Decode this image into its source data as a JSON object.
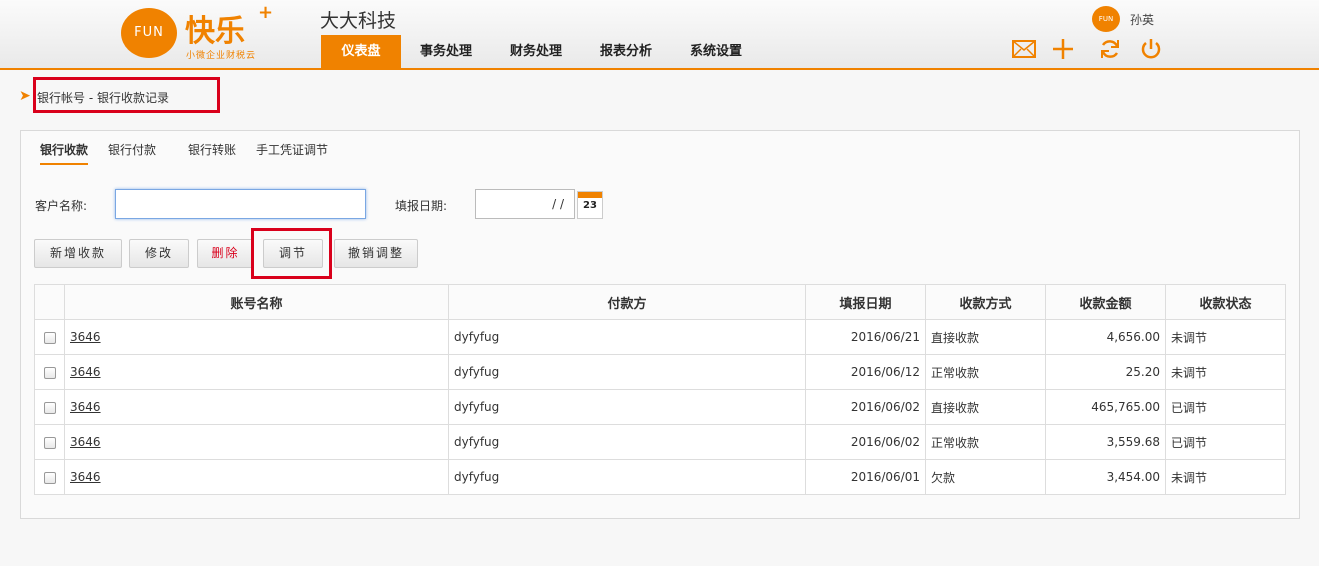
{
  "header": {
    "logo_text": "FUN",
    "logo_name": "快乐",
    "logo_plus": "+",
    "logo_slogan": "小微企业财税云",
    "company": "大大科技",
    "nav": [
      "仪表盘",
      "事务处理",
      "财务处理",
      "报表分析",
      "系统设置"
    ],
    "user_avatar": "FUN",
    "user_name": "孙英",
    "icons": [
      "mail-icon",
      "add-icon",
      "refresh-icon",
      "power-icon"
    ]
  },
  "breadcrumb": "银行帐号 - 银行收款记录",
  "tabs": [
    "银行收款",
    "银行付款",
    "银行转账",
    "手工凭证调节"
  ],
  "form": {
    "customer_label": "客户名称:",
    "customer_value": "",
    "date_label": "填报日期:",
    "date_value": "/ /",
    "calendar_day": "23"
  },
  "buttons": {
    "add": "新增收款",
    "edit": "修改",
    "delete": "删除",
    "adjust": "调节",
    "undo_adjust": "撤销调整"
  },
  "table": {
    "headers": [
      "账号名称",
      "付款方",
      "填报日期",
      "收款方式",
      "收款金额",
      "收款状态"
    ],
    "rows": [
      {
        "account": "3646",
        "payer": "dyfyfug",
        "date": "2016/06/21",
        "method": "直接收款",
        "amount": "4,656.00",
        "status": "未调节"
      },
      {
        "account": "3646",
        "payer": "dyfyfug",
        "date": "2016/06/12",
        "method": "正常收款",
        "amount": "25.20",
        "status": "未调节"
      },
      {
        "account": "3646",
        "payer": "dyfyfug",
        "date": "2016/06/02",
        "method": "直接收款",
        "amount": "465,765.00",
        "status": "已调节"
      },
      {
        "account": "3646",
        "payer": "dyfyfug",
        "date": "2016/06/02",
        "method": "正常收款",
        "amount": "3,559.68",
        "status": "已调节"
      },
      {
        "account": "3646",
        "payer": "dyfyfug",
        "date": "2016/06/01",
        "method": "欠款",
        "amount": "3,454.00",
        "status": "未调节"
      }
    ]
  },
  "colors": {
    "accent": "#f08200",
    "highlight_box": "#d9001b"
  }
}
